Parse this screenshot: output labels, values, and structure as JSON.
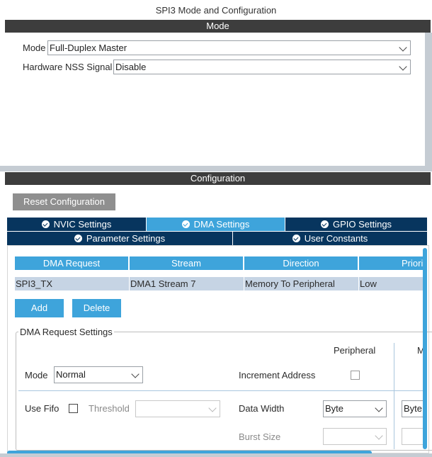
{
  "window": {
    "title": "SPI3 Mode and Configuration"
  },
  "mode_section": {
    "header": "Mode",
    "mode_label": "Mode",
    "mode_value": "Full-Duplex Master",
    "nss_label": "Hardware NSS Signal",
    "nss_value": "Disable"
  },
  "config_section": {
    "header": "Configuration",
    "reset_button": "Reset Configuration"
  },
  "tabs": [
    {
      "label": "NVIC Settings",
      "active": false
    },
    {
      "label": "DMA Settings",
      "active": true
    },
    {
      "label": "GPIO Settings",
      "active": false
    },
    {
      "label": "Parameter Settings",
      "active": false
    },
    {
      "label": "User Constants",
      "active": false
    }
  ],
  "dma_table": {
    "columns": [
      "DMA Request",
      "Stream",
      "Direction",
      "Priori"
    ],
    "rows": [
      [
        "SPI3_TX",
        "DMA1 Stream 7",
        "Memory To Peripheral",
        "Low"
      ]
    ]
  },
  "actions": {
    "add": "Add",
    "delete": "Delete"
  },
  "request_settings": {
    "legend": "DMA Request Settings",
    "peripheral_header": "Peripheral",
    "memory_header_partial": "M",
    "mode_label": "Mode",
    "mode_value": "Normal",
    "increment_label": "Increment Address",
    "use_fifo_label": "Use Fifo",
    "threshold_label": "Threshold",
    "threshold_value": "",
    "data_width_label": "Data Width",
    "data_width_peripheral": "Byte",
    "data_width_memory": "Byte",
    "burst_size_label": "Burst Size",
    "burst_size_peripheral": "",
    "burst_size_memory": ""
  },
  "colors": {
    "accent": "#3ea4db",
    "tab_dark": "#07355e",
    "header_bar": "#3d3d3d",
    "row_selected": "#c6d4e4"
  }
}
